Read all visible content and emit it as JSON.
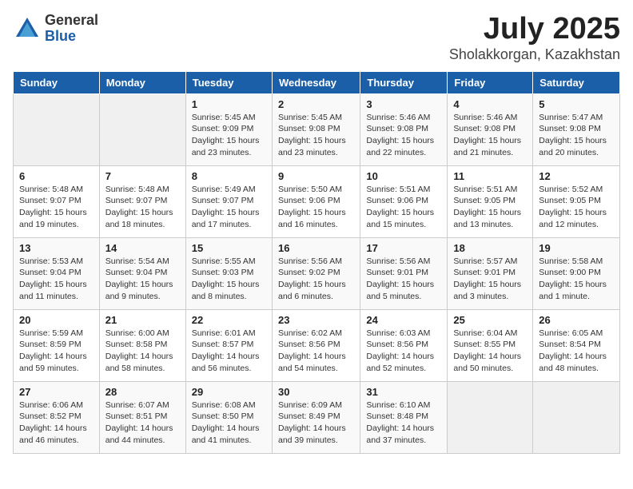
{
  "logo": {
    "general": "General",
    "blue": "Blue"
  },
  "title": {
    "month": "July 2025",
    "location": "Sholakkorgan, Kazakhstan"
  },
  "headers": [
    "Sunday",
    "Monday",
    "Tuesday",
    "Wednesday",
    "Thursday",
    "Friday",
    "Saturday"
  ],
  "weeks": [
    [
      {
        "day": "",
        "info": ""
      },
      {
        "day": "",
        "info": ""
      },
      {
        "day": "1",
        "info": "Sunrise: 5:45 AM\nSunset: 9:09 PM\nDaylight: 15 hours and 23 minutes."
      },
      {
        "day": "2",
        "info": "Sunrise: 5:45 AM\nSunset: 9:08 PM\nDaylight: 15 hours and 23 minutes."
      },
      {
        "day": "3",
        "info": "Sunrise: 5:46 AM\nSunset: 9:08 PM\nDaylight: 15 hours and 22 minutes."
      },
      {
        "day": "4",
        "info": "Sunrise: 5:46 AM\nSunset: 9:08 PM\nDaylight: 15 hours and 21 minutes."
      },
      {
        "day": "5",
        "info": "Sunrise: 5:47 AM\nSunset: 9:08 PM\nDaylight: 15 hours and 20 minutes."
      }
    ],
    [
      {
        "day": "6",
        "info": "Sunrise: 5:48 AM\nSunset: 9:07 PM\nDaylight: 15 hours and 19 minutes."
      },
      {
        "day": "7",
        "info": "Sunrise: 5:48 AM\nSunset: 9:07 PM\nDaylight: 15 hours and 18 minutes."
      },
      {
        "day": "8",
        "info": "Sunrise: 5:49 AM\nSunset: 9:07 PM\nDaylight: 15 hours and 17 minutes."
      },
      {
        "day": "9",
        "info": "Sunrise: 5:50 AM\nSunset: 9:06 PM\nDaylight: 15 hours and 16 minutes."
      },
      {
        "day": "10",
        "info": "Sunrise: 5:51 AM\nSunset: 9:06 PM\nDaylight: 15 hours and 15 minutes."
      },
      {
        "day": "11",
        "info": "Sunrise: 5:51 AM\nSunset: 9:05 PM\nDaylight: 15 hours and 13 minutes."
      },
      {
        "day": "12",
        "info": "Sunrise: 5:52 AM\nSunset: 9:05 PM\nDaylight: 15 hours and 12 minutes."
      }
    ],
    [
      {
        "day": "13",
        "info": "Sunrise: 5:53 AM\nSunset: 9:04 PM\nDaylight: 15 hours and 11 minutes."
      },
      {
        "day": "14",
        "info": "Sunrise: 5:54 AM\nSunset: 9:04 PM\nDaylight: 15 hours and 9 minutes."
      },
      {
        "day": "15",
        "info": "Sunrise: 5:55 AM\nSunset: 9:03 PM\nDaylight: 15 hours and 8 minutes."
      },
      {
        "day": "16",
        "info": "Sunrise: 5:56 AM\nSunset: 9:02 PM\nDaylight: 15 hours and 6 minutes."
      },
      {
        "day": "17",
        "info": "Sunrise: 5:56 AM\nSunset: 9:01 PM\nDaylight: 15 hours and 5 minutes."
      },
      {
        "day": "18",
        "info": "Sunrise: 5:57 AM\nSunset: 9:01 PM\nDaylight: 15 hours and 3 minutes."
      },
      {
        "day": "19",
        "info": "Sunrise: 5:58 AM\nSunset: 9:00 PM\nDaylight: 15 hours and 1 minute."
      }
    ],
    [
      {
        "day": "20",
        "info": "Sunrise: 5:59 AM\nSunset: 8:59 PM\nDaylight: 14 hours and 59 minutes."
      },
      {
        "day": "21",
        "info": "Sunrise: 6:00 AM\nSunset: 8:58 PM\nDaylight: 14 hours and 58 minutes."
      },
      {
        "day": "22",
        "info": "Sunrise: 6:01 AM\nSunset: 8:57 PM\nDaylight: 14 hours and 56 minutes."
      },
      {
        "day": "23",
        "info": "Sunrise: 6:02 AM\nSunset: 8:56 PM\nDaylight: 14 hours and 54 minutes."
      },
      {
        "day": "24",
        "info": "Sunrise: 6:03 AM\nSunset: 8:56 PM\nDaylight: 14 hours and 52 minutes."
      },
      {
        "day": "25",
        "info": "Sunrise: 6:04 AM\nSunset: 8:55 PM\nDaylight: 14 hours and 50 minutes."
      },
      {
        "day": "26",
        "info": "Sunrise: 6:05 AM\nSunset: 8:54 PM\nDaylight: 14 hours and 48 minutes."
      }
    ],
    [
      {
        "day": "27",
        "info": "Sunrise: 6:06 AM\nSunset: 8:52 PM\nDaylight: 14 hours and 46 minutes."
      },
      {
        "day": "28",
        "info": "Sunrise: 6:07 AM\nSunset: 8:51 PM\nDaylight: 14 hours and 44 minutes."
      },
      {
        "day": "29",
        "info": "Sunrise: 6:08 AM\nSunset: 8:50 PM\nDaylight: 14 hours and 41 minutes."
      },
      {
        "day": "30",
        "info": "Sunrise: 6:09 AM\nSunset: 8:49 PM\nDaylight: 14 hours and 39 minutes."
      },
      {
        "day": "31",
        "info": "Sunrise: 6:10 AM\nSunset: 8:48 PM\nDaylight: 14 hours and 37 minutes."
      },
      {
        "day": "",
        "info": ""
      },
      {
        "day": "",
        "info": ""
      }
    ]
  ]
}
